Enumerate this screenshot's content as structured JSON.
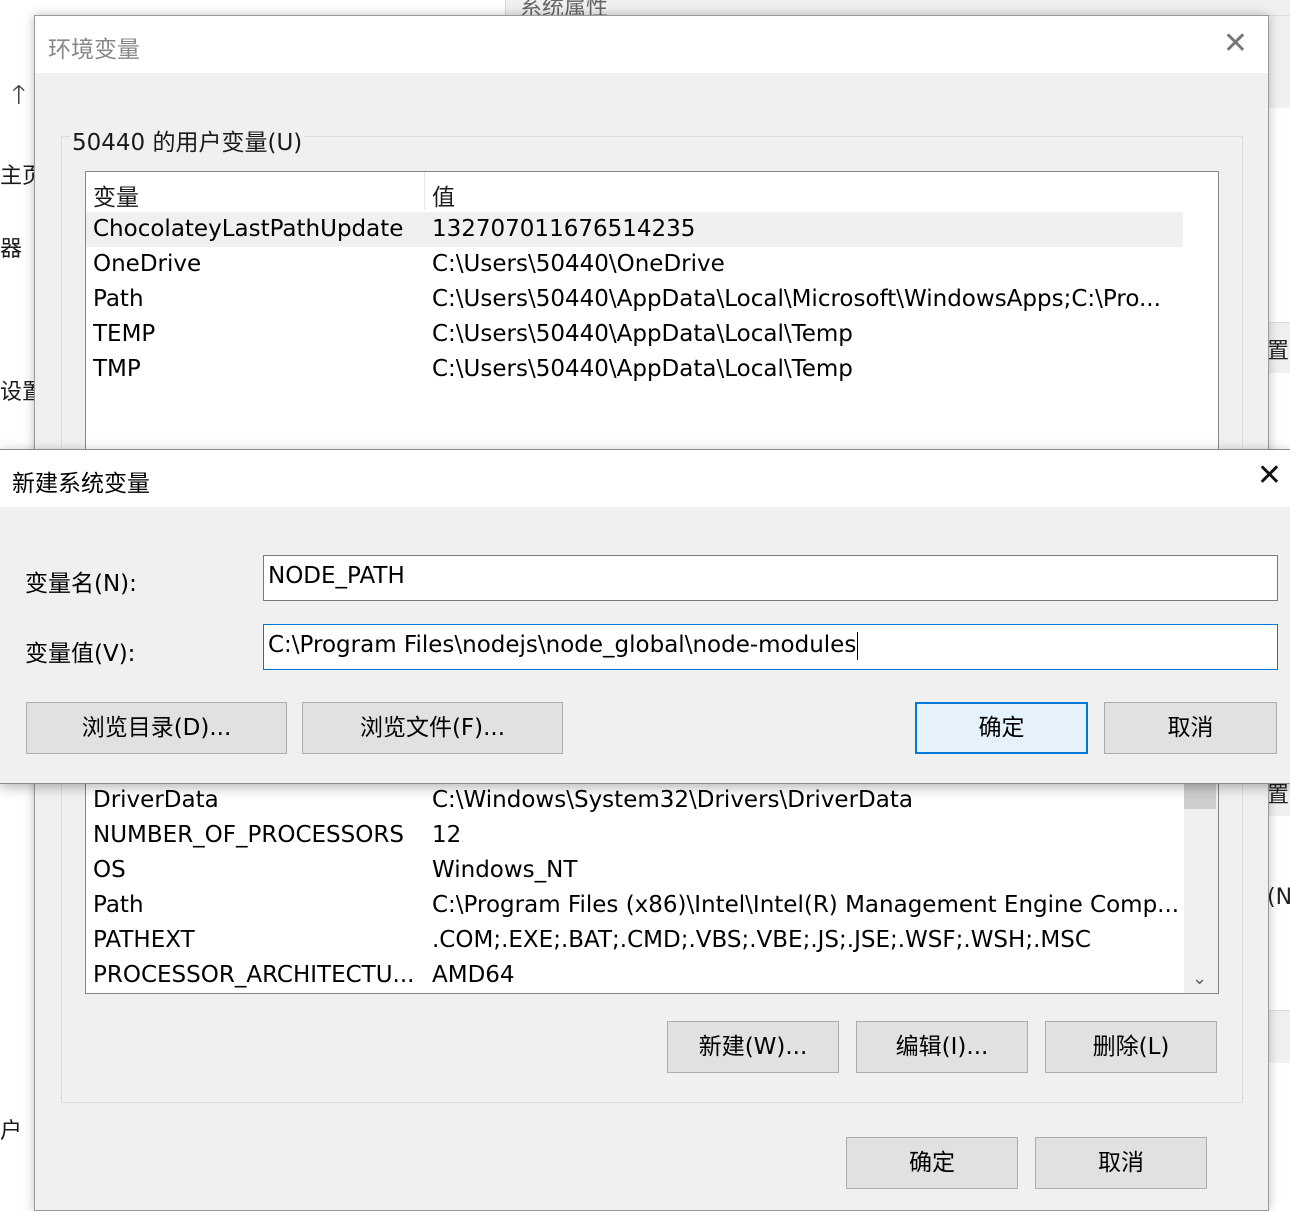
{
  "background": {
    "left_fragments": [
      "主页",
      "器",
      "设置",
      "户"
    ],
    "sys_props_title": "系统属性",
    "right_fragments": [
      "置",
      "置",
      "(N"
    ]
  },
  "env_dialog": {
    "title": "环境变量",
    "user_group_label": "50440 的用户变量(U)",
    "user_columns": [
      "变量",
      "值"
    ],
    "user_vars": [
      {
        "name": "ChocolateyLastPathUpdate",
        "value": "132707011676514235"
      },
      {
        "name": "OneDrive",
        "value": "C:\\Users\\50440\\OneDrive"
      },
      {
        "name": "Path",
        "value": "C:\\Users\\50440\\AppData\\Local\\Microsoft\\WindowsApps;C:\\Pro..."
      },
      {
        "name": "TEMP",
        "value": "C:\\Users\\50440\\AppData\\Local\\Temp"
      },
      {
        "name": "TMP",
        "value": "C:\\Users\\50440\\AppData\\Local\\Temp"
      }
    ],
    "system_vars": [
      {
        "name": "DriverData",
        "value": "C:\\Windows\\System32\\Drivers\\DriverData"
      },
      {
        "name": "NUMBER_OF_PROCESSORS",
        "value": "12"
      },
      {
        "name": "OS",
        "value": "Windows_NT"
      },
      {
        "name": "Path",
        "value": "C:\\Program Files (x86)\\Intel\\Intel(R) Management Engine Comp..."
      },
      {
        "name": "PATHEXT",
        "value": ".COM;.EXE;.BAT;.CMD;.VBS;.VBE;.JS;.JSE;.WSF;.WSH;.MSC"
      },
      {
        "name": "PROCESSOR_ARCHITECTU...",
        "value": "AMD64"
      }
    ],
    "system_buttons": {
      "new": "新建(W)...",
      "edit": "编辑(I)...",
      "delete": "删除(L)"
    },
    "ok": "确定",
    "cancel": "取消"
  },
  "new_var_dialog": {
    "title": "新建系统变量",
    "name_label": "变量名(N):",
    "name_value": "NODE_PATH",
    "value_label": "变量值(V):",
    "value_value": "C:\\Program Files\\nodejs\\node_global\\node-modules",
    "browse_dir": "浏览目录(D)...",
    "browse_file": "浏览文件(F)...",
    "ok": "确定",
    "cancel": "取消"
  }
}
